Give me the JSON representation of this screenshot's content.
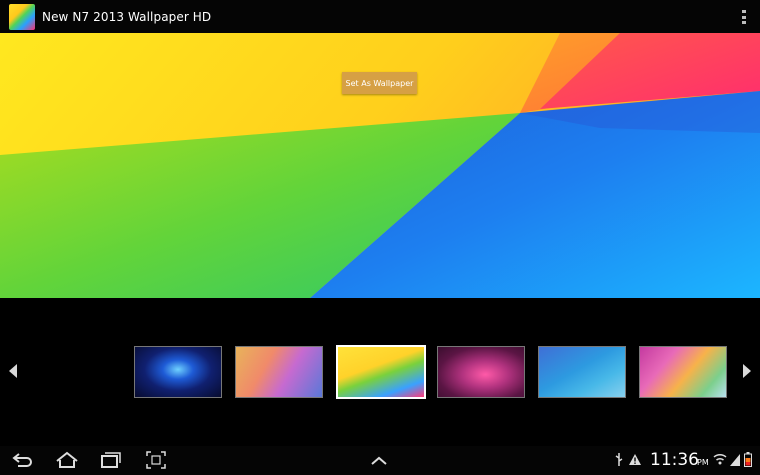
{
  "app": {
    "title": "New N7 2013 Wallpaper HD"
  },
  "icons": {
    "app_icon": "wallpaper-app-icon",
    "overflow": "overflow-menu-icon",
    "prev": "arrow-left-icon",
    "next": "arrow-right-icon",
    "back": "back-icon",
    "home": "home-icon",
    "recents": "recent-apps-icon",
    "screenshot": "screenshot-icon",
    "up": "chevron-up-icon",
    "usb": "usb-icon",
    "warning": "warning-icon",
    "wifi": "wifi-icon",
    "signal": "signal-icon",
    "battery": "battery-icon"
  },
  "preview": {
    "set_button_label": "Set As Wallpaper"
  },
  "gallery": {
    "thumbnails": [
      {
        "selected": false
      },
      {
        "selected": false
      },
      {
        "selected": true
      },
      {
        "selected": false
      },
      {
        "selected": false
      },
      {
        "selected": false
      }
    ]
  },
  "status": {
    "time": "11:36",
    "ampm": "PM"
  },
  "colors": {
    "button_bg": "#d6a044",
    "background": "#000000"
  }
}
